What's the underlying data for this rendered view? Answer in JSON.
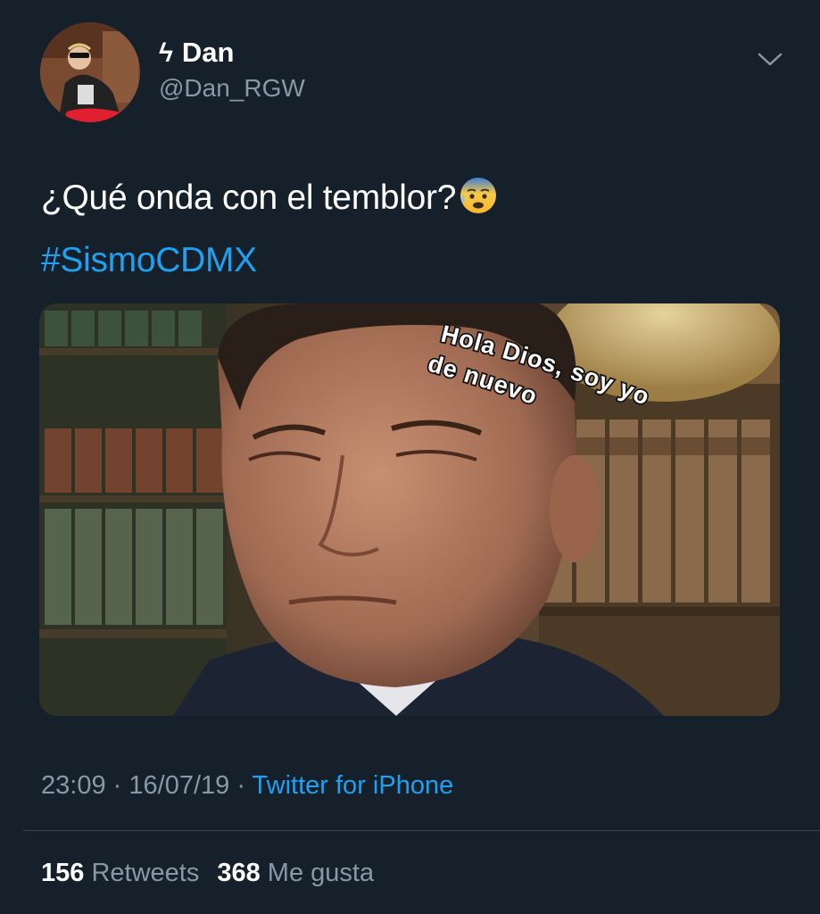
{
  "author": {
    "display_name": "Dan",
    "name_prefix_icon": "lightning-bolt-icon",
    "name_prefix_glyph": "ϟ",
    "handle": "@Dan_RGW",
    "avatar_icon": "profile-photo"
  },
  "menu": {
    "icon": "chevron-down-icon"
  },
  "tweet": {
    "text": "¿Qué onda con el temblor?",
    "emoji_icon": "anxious-face-with-sweat-emoji",
    "hashtag": "#SismoCDMX"
  },
  "media": {
    "caption_line1": "Hola Dios, soy yo",
    "caption_line2": "de nuevo"
  },
  "meta": {
    "time": "23:09",
    "separator": "·",
    "date": "16/07/19",
    "source": "Twitter for iPhone"
  },
  "stats": {
    "retweets_count": "156",
    "retweets_label": "Retweets",
    "likes_count": "368",
    "likes_label": "Me gusta"
  },
  "colors": {
    "background": "#15202b",
    "link": "#1da1f2",
    "secondary_text": "#8899a6",
    "divider": "#38444d"
  }
}
